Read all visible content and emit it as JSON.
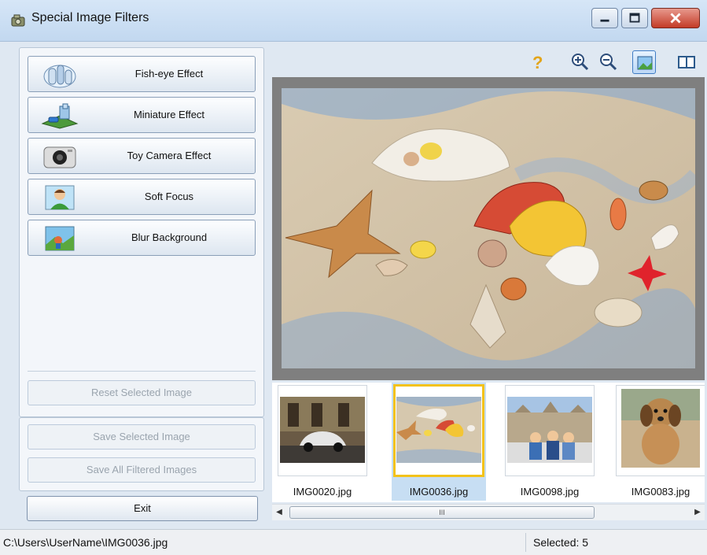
{
  "window": {
    "title": "Special Image Filters"
  },
  "effects": [
    {
      "label": "Fish-eye Effect",
      "icon": "fish-eye-icon"
    },
    {
      "label": "Miniature Effect",
      "icon": "miniature-icon"
    },
    {
      "label": "Toy Camera Effect",
      "icon": "toy-camera-icon"
    },
    {
      "label": "Soft Focus",
      "icon": "soft-focus-icon"
    },
    {
      "label": "Blur Background",
      "icon": "blur-background-icon"
    }
  ],
  "actions": {
    "reset": "Reset Selected Image",
    "save_selected": "Save Selected Image",
    "save_all": "Save All Filtered Images",
    "exit": "Exit"
  },
  "thumbnails": [
    {
      "name": "IMG0020.jpg",
      "selected": false
    },
    {
      "name": "IMG0036.jpg",
      "selected": true
    },
    {
      "name": "IMG0098.jpg",
      "selected": false
    },
    {
      "name": "IMG0083.jpg",
      "selected": false
    }
  ],
  "status": {
    "path": "C:\\Users\\UserName\\IMG0036.jpg",
    "selected": "Selected: 5"
  },
  "scrollbar": {
    "grip": "III"
  },
  "colors": {
    "accent": "#3f7cc4",
    "selection": "#f3c21b"
  }
}
